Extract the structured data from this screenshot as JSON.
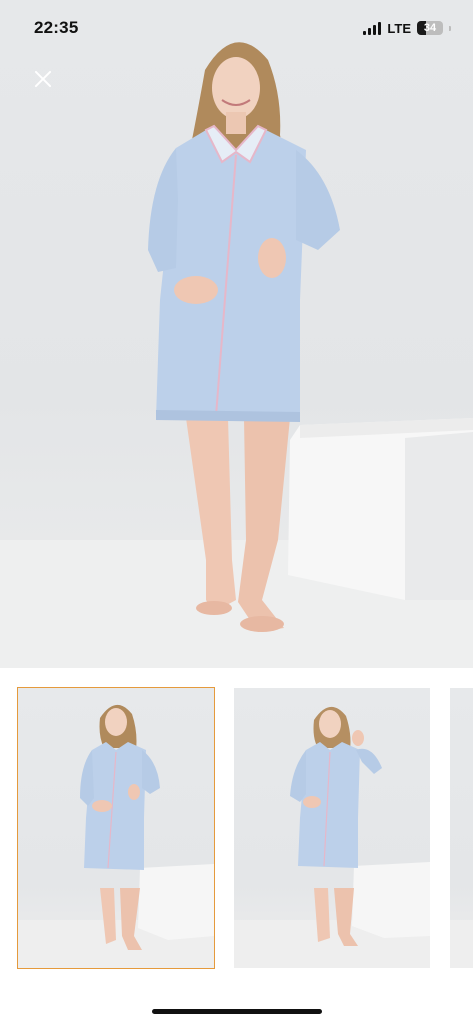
{
  "status_bar": {
    "time": "22:35",
    "network": "LTE",
    "battery_level": "34",
    "battery_fraction": 0.34
  },
  "close_button": {
    "icon": "close-icon"
  },
  "gallery": {
    "main_image_alt": "",
    "selected_index": 0,
    "thumbnails": [
      {
        "pose": "hands-on-belly",
        "selected": true
      },
      {
        "pose": "hand-raised",
        "selected": false
      },
      {
        "pose": "partial",
        "selected": false
      }
    ]
  },
  "colors": {
    "accent_selected": "#e59a3c",
    "garment": "#bcd0ea",
    "piping": "#e6b7c9"
  }
}
